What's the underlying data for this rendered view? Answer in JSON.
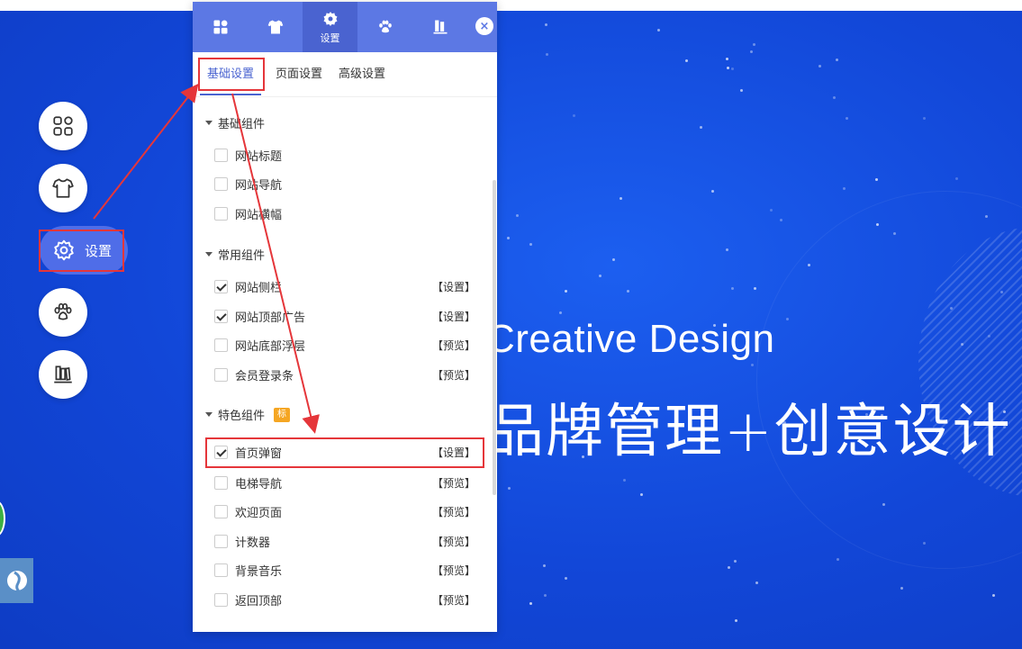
{
  "hero": {
    "title_en": "Creative Design",
    "title_cn": "品牌管理+创意设计"
  },
  "side_nav": {
    "items": [
      {
        "icon": "grid-icon"
      },
      {
        "icon": "tshirt-icon"
      },
      {
        "icon": "gear-icon",
        "label": "设置",
        "active": true
      },
      {
        "icon": "paw-icon"
      },
      {
        "icon": "books-icon"
      }
    ]
  },
  "panel": {
    "header_tabs": [
      {
        "icon": "grid-icon"
      },
      {
        "icon": "tshirt-icon"
      },
      {
        "icon": "gear-icon",
        "label": "设置",
        "active": true
      },
      {
        "icon": "paw-icon"
      },
      {
        "icon": "books-icon"
      }
    ],
    "close_glyph": "×",
    "sub_tabs": [
      "基础设置",
      "页面设置",
      "高级设置"
    ],
    "groups": [
      {
        "title": "基础组件",
        "items": [
          {
            "label": "网站标题",
            "checked": false,
            "action": ""
          },
          {
            "label": "网站导航",
            "checked": false,
            "action": ""
          },
          {
            "label": "网站横幅",
            "checked": false,
            "action": ""
          }
        ]
      },
      {
        "title": "常用组件",
        "items": [
          {
            "label": "网站侧栏",
            "checked": true,
            "action": "【设置】"
          },
          {
            "label": "网站顶部广告",
            "checked": true,
            "action": "【设置】"
          },
          {
            "label": "网站底部浮层",
            "checked": false,
            "action": "【预览】"
          },
          {
            "label": "会员登录条",
            "checked": false,
            "action": "【预览】"
          }
        ]
      },
      {
        "title": "特色组件",
        "badge": "标",
        "items": [
          {
            "label": "首页弹窗",
            "checked": true,
            "action": "【设置】"
          },
          {
            "label": "电梯导航",
            "checked": false,
            "action": "【预览】"
          },
          {
            "label": "欢迎页面",
            "checked": false,
            "action": "【预览】"
          },
          {
            "label": "计数器",
            "checked": false,
            "action": "【预览】"
          },
          {
            "label": "背景音乐",
            "checked": false,
            "action": "【预览】"
          },
          {
            "label": "返回顶部",
            "checked": false,
            "action": "【预览】"
          }
        ]
      }
    ]
  },
  "colors": {
    "accent": "#5c78e4",
    "highlight": "#e5363a",
    "hero_bg": "#1247d8"
  }
}
